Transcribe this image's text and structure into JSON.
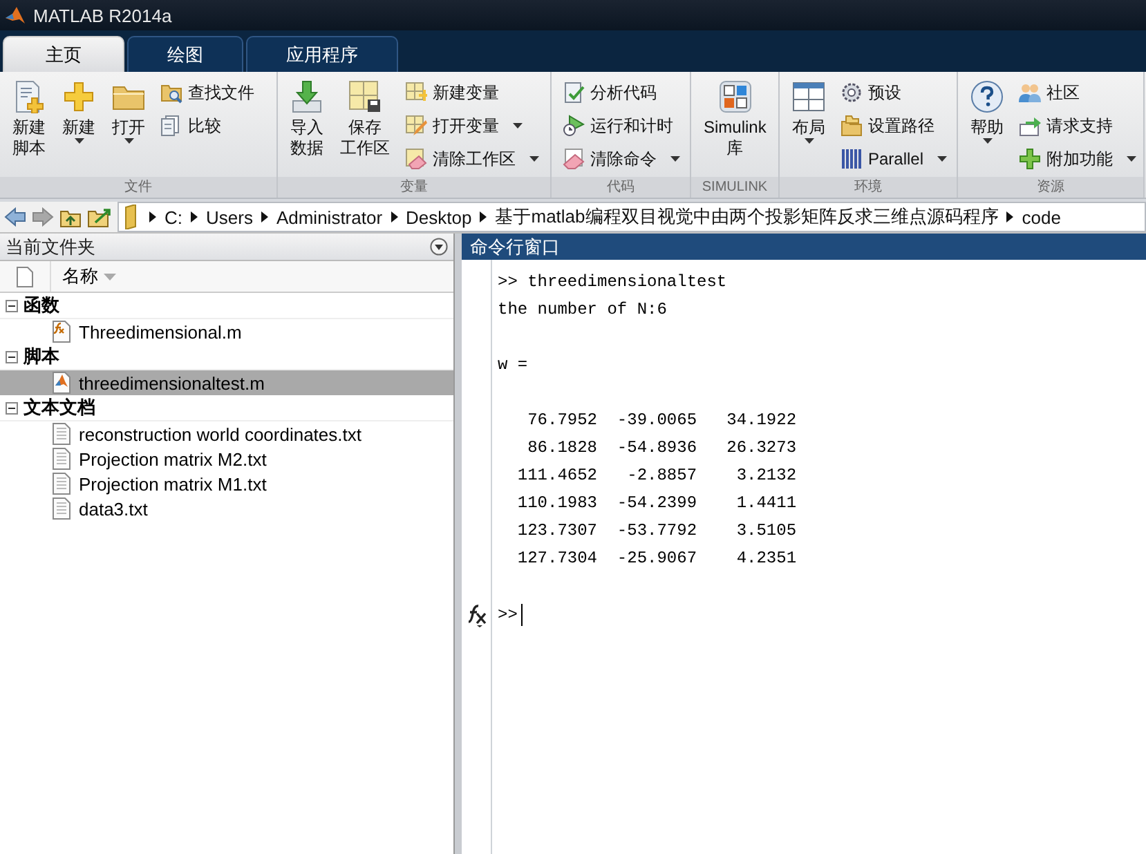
{
  "window": {
    "title": "MATLAB R2014a"
  },
  "tabs": [
    {
      "label": "主页",
      "selected": true
    },
    {
      "label": "绘图",
      "selected": false
    },
    {
      "label": "应用程序",
      "selected": false
    }
  ],
  "ribbon": {
    "sections": [
      {
        "label": "文件",
        "items": [
          {
            "kind": "large",
            "lines": [
              "新建",
              "脚本"
            ],
            "dropdown": false
          },
          {
            "kind": "large",
            "lines": [
              "新建"
            ],
            "dropdown": true
          },
          {
            "kind": "large",
            "lines": [
              "打开"
            ],
            "dropdown": true
          },
          {
            "kind": "small",
            "label": "查找文件",
            "dropdown": false
          },
          {
            "kind": "small",
            "label": "比较",
            "dropdown": false
          }
        ]
      },
      {
        "label": "变量",
        "items": [
          {
            "kind": "large",
            "lines": [
              "导入",
              "数据"
            ],
            "dropdown": false
          },
          {
            "kind": "large",
            "lines": [
              "保存",
              "工作区"
            ],
            "dropdown": false
          },
          {
            "kind": "small",
            "label": "新建变量",
            "dropdown": false
          },
          {
            "kind": "small",
            "label": "打开变量",
            "dropdown": true
          },
          {
            "kind": "small",
            "label": "清除工作区",
            "dropdown": true
          }
        ]
      },
      {
        "label": "代码",
        "items": [
          {
            "kind": "small",
            "label": "分析代码",
            "dropdown": false
          },
          {
            "kind": "small",
            "label": "运行和计时",
            "dropdown": false
          },
          {
            "kind": "small",
            "label": "清除命令",
            "dropdown": true
          }
        ]
      },
      {
        "label": "SIMULINK",
        "items": [
          {
            "kind": "large",
            "lines": [
              "Simulink",
              "库"
            ],
            "dropdown": false
          }
        ]
      },
      {
        "label": "环境",
        "items": [
          {
            "kind": "large",
            "lines": [
              "布局"
            ],
            "dropdown": true
          },
          {
            "kind": "small",
            "label": "预设",
            "dropdown": false
          },
          {
            "kind": "small",
            "label": "设置路径",
            "dropdown": false
          },
          {
            "kind": "small",
            "label": "Parallel",
            "dropdown": true
          }
        ]
      },
      {
        "label": "资源",
        "items": [
          {
            "kind": "large",
            "lines": [
              "帮助"
            ],
            "dropdown": true
          },
          {
            "kind": "small",
            "label": "社区",
            "dropdown": false
          },
          {
            "kind": "small",
            "label": "请求支持",
            "dropdown": false
          },
          {
            "kind": "small",
            "label": "附加功能",
            "dropdown": true
          }
        ]
      }
    ]
  },
  "address_bar": {
    "path": [
      "C:",
      "Users",
      "Administrator",
      "Desktop",
      "基于matlab编程双目视觉中由两个投影矩阵反求三维点源码程序",
      "code"
    ]
  },
  "current_folder": {
    "title": "当前文件夹",
    "column": "名称",
    "groups": [
      {
        "label": "函数",
        "expanded": true,
        "files": [
          {
            "name": "Threedimensional.m",
            "kind": "function",
            "selected": false
          }
        ]
      },
      {
        "label": "脚本",
        "expanded": true,
        "files": [
          {
            "name": "threedimensionaltest.m",
            "kind": "script",
            "selected": true
          }
        ]
      },
      {
        "label": "文本文档",
        "expanded": true,
        "files": [
          {
            "name": "reconstruction world coordinates.txt",
            "kind": "text",
            "selected": false
          },
          {
            "name": "Projection matrix M2.txt",
            "kind": "text",
            "selected": false
          },
          {
            "name": "Projection matrix M1.txt",
            "kind": "text",
            "selected": false
          },
          {
            "name": "data3.txt",
            "kind": "text",
            "selected": false
          }
        ]
      }
    ]
  },
  "command_window": {
    "title": "命令行窗口",
    "lines": [
      {
        "kind": "command",
        "text": ">> threedimensionaltest"
      },
      {
        "kind": "output",
        "text": "the number of N:6"
      },
      {
        "kind": "variable",
        "text": "w ="
      },
      {
        "kind": "matrix_row",
        "text": "   76.7952  -39.0065   34.1922"
      },
      {
        "kind": "matrix_row",
        "text": "   86.1828  -54.8936   26.3273"
      },
      {
        "kind": "matrix_row",
        "text": "  111.4652   -2.8857    3.2132"
      },
      {
        "kind": "matrix_row",
        "text": "  110.1983  -54.2399    1.4411"
      },
      {
        "kind": "matrix_row",
        "text": "  123.7307  -53.7792    3.5105"
      },
      {
        "kind": "matrix_row",
        "text": "  127.7304  -25.9067    4.2351"
      }
    ],
    "prompt": ">>"
  }
}
